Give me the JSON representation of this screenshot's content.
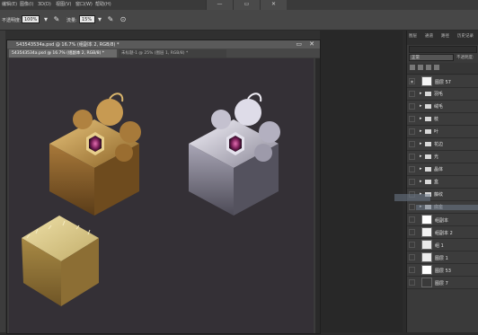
{
  "menubar": {
    "items": [
      "编辑(E)",
      "图像(I)",
      "3D(D)",
      "视图(V)",
      "窗口(W)",
      "帮助(H)"
    ],
    "window_buttons": [
      "—",
      "▭",
      "✕"
    ]
  },
  "options": {
    "opacity_label": "不透明度:",
    "opacity_value": "100%",
    "flow_label": "流量:",
    "flow_value": "15%"
  },
  "document": {
    "title": "543543534a.psd @ 16.7% (组副本 2, RGB/8) *",
    "tabs": [
      "543543534a.psd @ 16.7% (组副本 2, RGB/8) *",
      "未标题-1 @ 25% (图层 1, RGB/8) *"
    ]
  },
  "panel": {
    "tabs": [
      "图层",
      "通道",
      "路径",
      "历史记录"
    ],
    "blend_mode": "正常",
    "opacity_label": "不透明度:",
    "layers": [
      {
        "type": "layer",
        "name": "图层 57",
        "visible": true
      },
      {
        "type": "group",
        "name": "羽毛",
        "visible": false
      },
      {
        "type": "group",
        "name": "绒毛",
        "visible": false
      },
      {
        "type": "group",
        "name": "枝",
        "visible": false
      },
      {
        "type": "group",
        "name": "叶",
        "visible": false
      },
      {
        "type": "group",
        "name": "花边",
        "visible": false
      },
      {
        "type": "group",
        "name": "光",
        "visible": false
      },
      {
        "type": "group",
        "name": "晶体",
        "visible": false
      },
      {
        "type": "group",
        "name": "盒",
        "visible": false
      },
      {
        "type": "group",
        "name": "藤纹",
        "visible": false
      },
      {
        "type": "group",
        "name": "底座",
        "visible": false
      },
      {
        "type": "layer",
        "name": "组副本",
        "visible": false
      },
      {
        "type": "layer",
        "name": "组副本 2",
        "visible": false
      },
      {
        "type": "layer",
        "name": "组 1",
        "visible": false
      },
      {
        "type": "layer",
        "name": "图层 1",
        "visible": false
      },
      {
        "type": "layer",
        "name": "图层 53",
        "visible": false
      },
      {
        "type": "layer",
        "name": "图层 7",
        "visible": false
      }
    ]
  },
  "colors": {
    "canvas_bg": "#343036",
    "gold": "#b8893e",
    "silver": "#b9b6c6",
    "crystal": "#8a2a62",
    "hay": "#d9c98e"
  }
}
